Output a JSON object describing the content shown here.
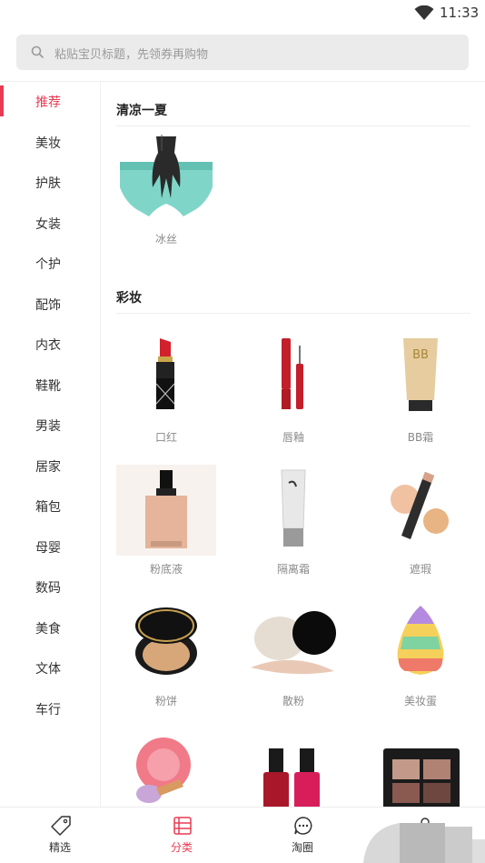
{
  "status_bar": {
    "time": "11:33",
    "wifi_icon": "wifi-icon"
  },
  "search": {
    "placeholder": "粘贴宝贝标题，先领券再购物",
    "icon": "search-icon"
  },
  "sidebar": {
    "items": [
      {
        "label": "推荐",
        "active": true
      },
      {
        "label": "美妆"
      },
      {
        "label": "护肤"
      },
      {
        "label": "女装"
      },
      {
        "label": "个护"
      },
      {
        "label": "配饰"
      },
      {
        "label": "内衣"
      },
      {
        "label": "鞋靴"
      },
      {
        "label": "男装"
      },
      {
        "label": "居家"
      },
      {
        "label": "箱包"
      },
      {
        "label": "母婴"
      },
      {
        "label": "数码"
      },
      {
        "label": "美食"
      },
      {
        "label": "文体"
      },
      {
        "label": "车行"
      }
    ]
  },
  "sections": [
    {
      "title": "清凉一夏",
      "items": [
        {
          "name": "冰丝"
        }
      ]
    },
    {
      "title": "彩妆",
      "items": [
        {
          "name": "口红"
        },
        {
          "name": "唇釉"
        },
        {
          "name": "BB霜"
        },
        {
          "name": "粉底液"
        },
        {
          "name": "隔离霜"
        },
        {
          "name": "遮瑕"
        },
        {
          "name": "粉饼"
        },
        {
          "name": "散粉"
        },
        {
          "name": "美妆蛋"
        },
        {
          "name": ""
        },
        {
          "name": ""
        },
        {
          "name": ""
        }
      ]
    }
  ],
  "bottom_nav": {
    "tabs": [
      {
        "label": "精选",
        "icon": "tag-icon"
      },
      {
        "label": "分类",
        "icon": "category-icon",
        "active": true
      },
      {
        "label": "淘圈",
        "icon": "chat-icon"
      },
      {
        "label": "",
        "icon": "profile-icon"
      }
    ]
  },
  "colors": {
    "accent": "#e83a52",
    "search_bg": "#ebebeb"
  }
}
